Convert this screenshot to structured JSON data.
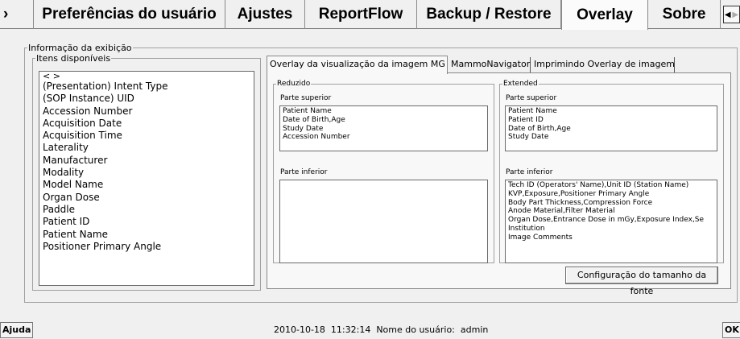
{
  "top_tabs": [
    {
      "label": "›"
    },
    {
      "label": "Preferências do usuário"
    },
    {
      "label": "Ajustes"
    },
    {
      "label": "ReportFlow"
    },
    {
      "label": "Backup / Restore"
    },
    {
      "label": "Overlay"
    },
    {
      "label": "Sobre"
    }
  ],
  "top_nav": {
    "prev_icon": "◀",
    "next_icon": "▶"
  },
  "display_info": {
    "group_label": "Informação da exibição",
    "available_items": {
      "label": "Itens disponíveis",
      "items": [
        "< >",
        "(Presentation) Intent Type",
        "(SOP Instance) UID",
        "Accession Number",
        "Acquisition Date",
        "Acquisition Time",
        "Laterality",
        "Manufacturer",
        "Modality",
        "Model Name",
        "Organ Dose",
        "Paddle",
        "Patient ID",
        "Patient Name",
        "Positioner Primary Angle"
      ]
    }
  },
  "inner_tabs": [
    {
      "label": "Overlay da visualização da imagem MG"
    },
    {
      "label": "MammoNavigator"
    },
    {
      "label": "Imprimindo Overlay de imagem"
    }
  ],
  "reduced": {
    "label": "Reduzido",
    "upper_label": "Parte superior",
    "upper_lines": [
      "Patient Name",
      "Date of Birth,Age",
      "Study Date",
      "Accession Number"
    ],
    "lower_label": "Parte inferior",
    "lower_lines": []
  },
  "extended": {
    "label": "Extended",
    "upper_label": "Parte superior",
    "upper_lines": [
      "Patient Name",
      "Patient ID",
      "Date of Birth,Age",
      "Study Date"
    ],
    "lower_label": "Parte inferior",
    "lower_lines": [
      "Tech ID (Operators' Name),Unit ID (Station Name)",
      "KVP,Exposure,Positioner Primary Angle",
      "Body Part Thickness,Compression Force",
      "Anode Material,Filter Material",
      "Organ Dose,Entrance Dose in mGy,Exposure Index,Se",
      "Institution",
      "Image Comments"
    ]
  },
  "font_size_button": "Configuração do tamanho da fonte",
  "status_bar": {
    "help_label": "Ajuda",
    "status_text": "2010-10-18  11:32:14  Nome do usuário:  admin",
    "ok_label": "OK"
  }
}
